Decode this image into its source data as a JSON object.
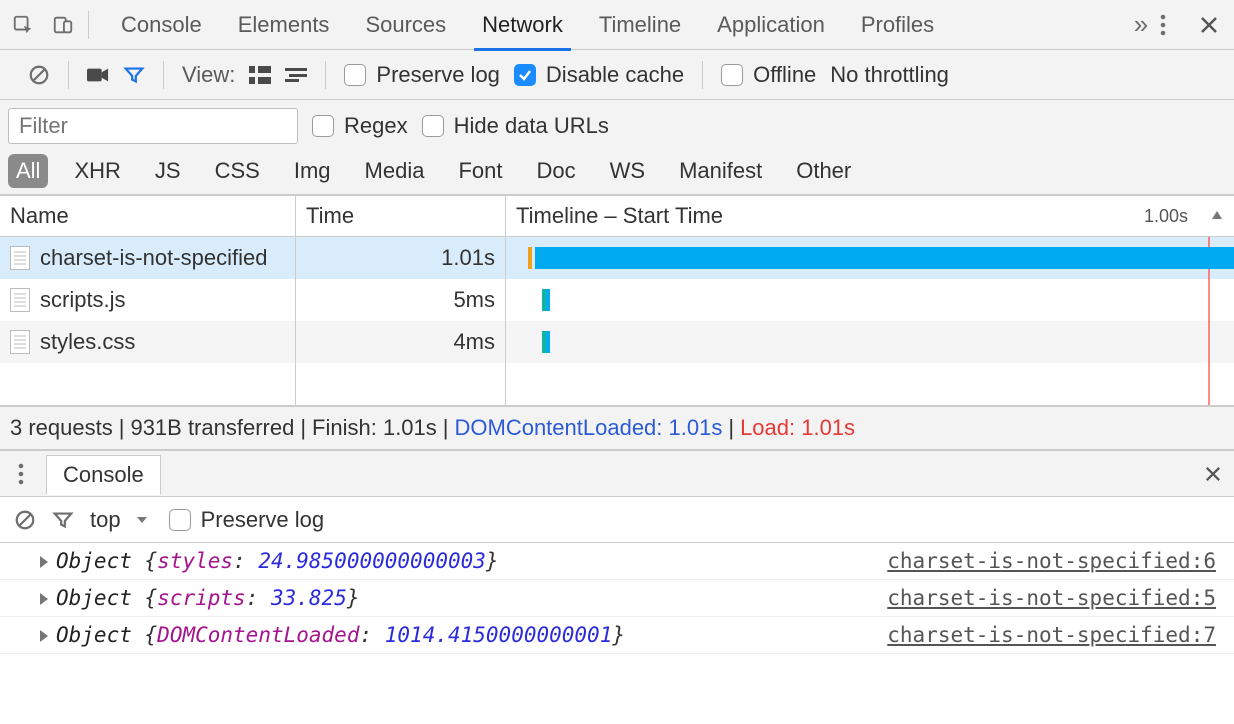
{
  "tabs": [
    "Console",
    "Elements",
    "Sources",
    "Network",
    "Timeline",
    "Application",
    "Profiles"
  ],
  "active_tab_index": 3,
  "toolbar": {
    "view_label": "View:",
    "preserve_log": "Preserve log",
    "disable_cache": "Disable cache",
    "offline": "Offline",
    "throttling": "No throttling"
  },
  "filter": {
    "placeholder": "Filter",
    "regex": "Regex",
    "hide_data_urls": "Hide data URLs",
    "pills": [
      "All",
      "XHR",
      "JS",
      "CSS",
      "Img",
      "Media",
      "Font",
      "Doc",
      "WS",
      "Manifest",
      "Other"
    ],
    "active_pill_index": 0
  },
  "grid": {
    "headers": {
      "name": "Name",
      "time": "Time",
      "timeline": "Timeline – Start Time"
    },
    "timeline_tick": "1.00s",
    "rows": [
      {
        "name": "charset-is-not-specified",
        "time": "1.01s",
        "bar": {
          "left_pct": 4.0,
          "width_pct": 96.0,
          "orange": true
        },
        "selected": true
      },
      {
        "name": "scripts.js",
        "time": "5ms",
        "bar": {
          "left_pct": 5.0,
          "width_pct": 1.0,
          "teal": true
        },
        "selected": false
      },
      {
        "name": "styles.css",
        "time": "4ms",
        "bar": {
          "left_pct": 5.0,
          "width_pct": 1.0,
          "teal": true
        },
        "selected": false
      }
    ],
    "summary": {
      "requests": "3 requests",
      "transferred": "931B transferred",
      "finish": "Finish: 1.01s",
      "dcl": "DOMContentLoaded: 1.01s",
      "load": "Load: 1.01s"
    }
  },
  "drawer": {
    "tab": "Console",
    "context": "top",
    "preserve_log": "Preserve log",
    "rows": [
      {
        "obj": "Object",
        "key": "styles",
        "val": "24.985000000000003",
        "src": "charset-is-not-specified:6"
      },
      {
        "obj": "Object",
        "key": "scripts",
        "val": "33.825",
        "src": "charset-is-not-specified:5"
      },
      {
        "obj": "Object",
        "key": "DOMContentLoaded",
        "val": "1014.4150000000001",
        "src": "charset-is-not-specified:7"
      }
    ]
  }
}
